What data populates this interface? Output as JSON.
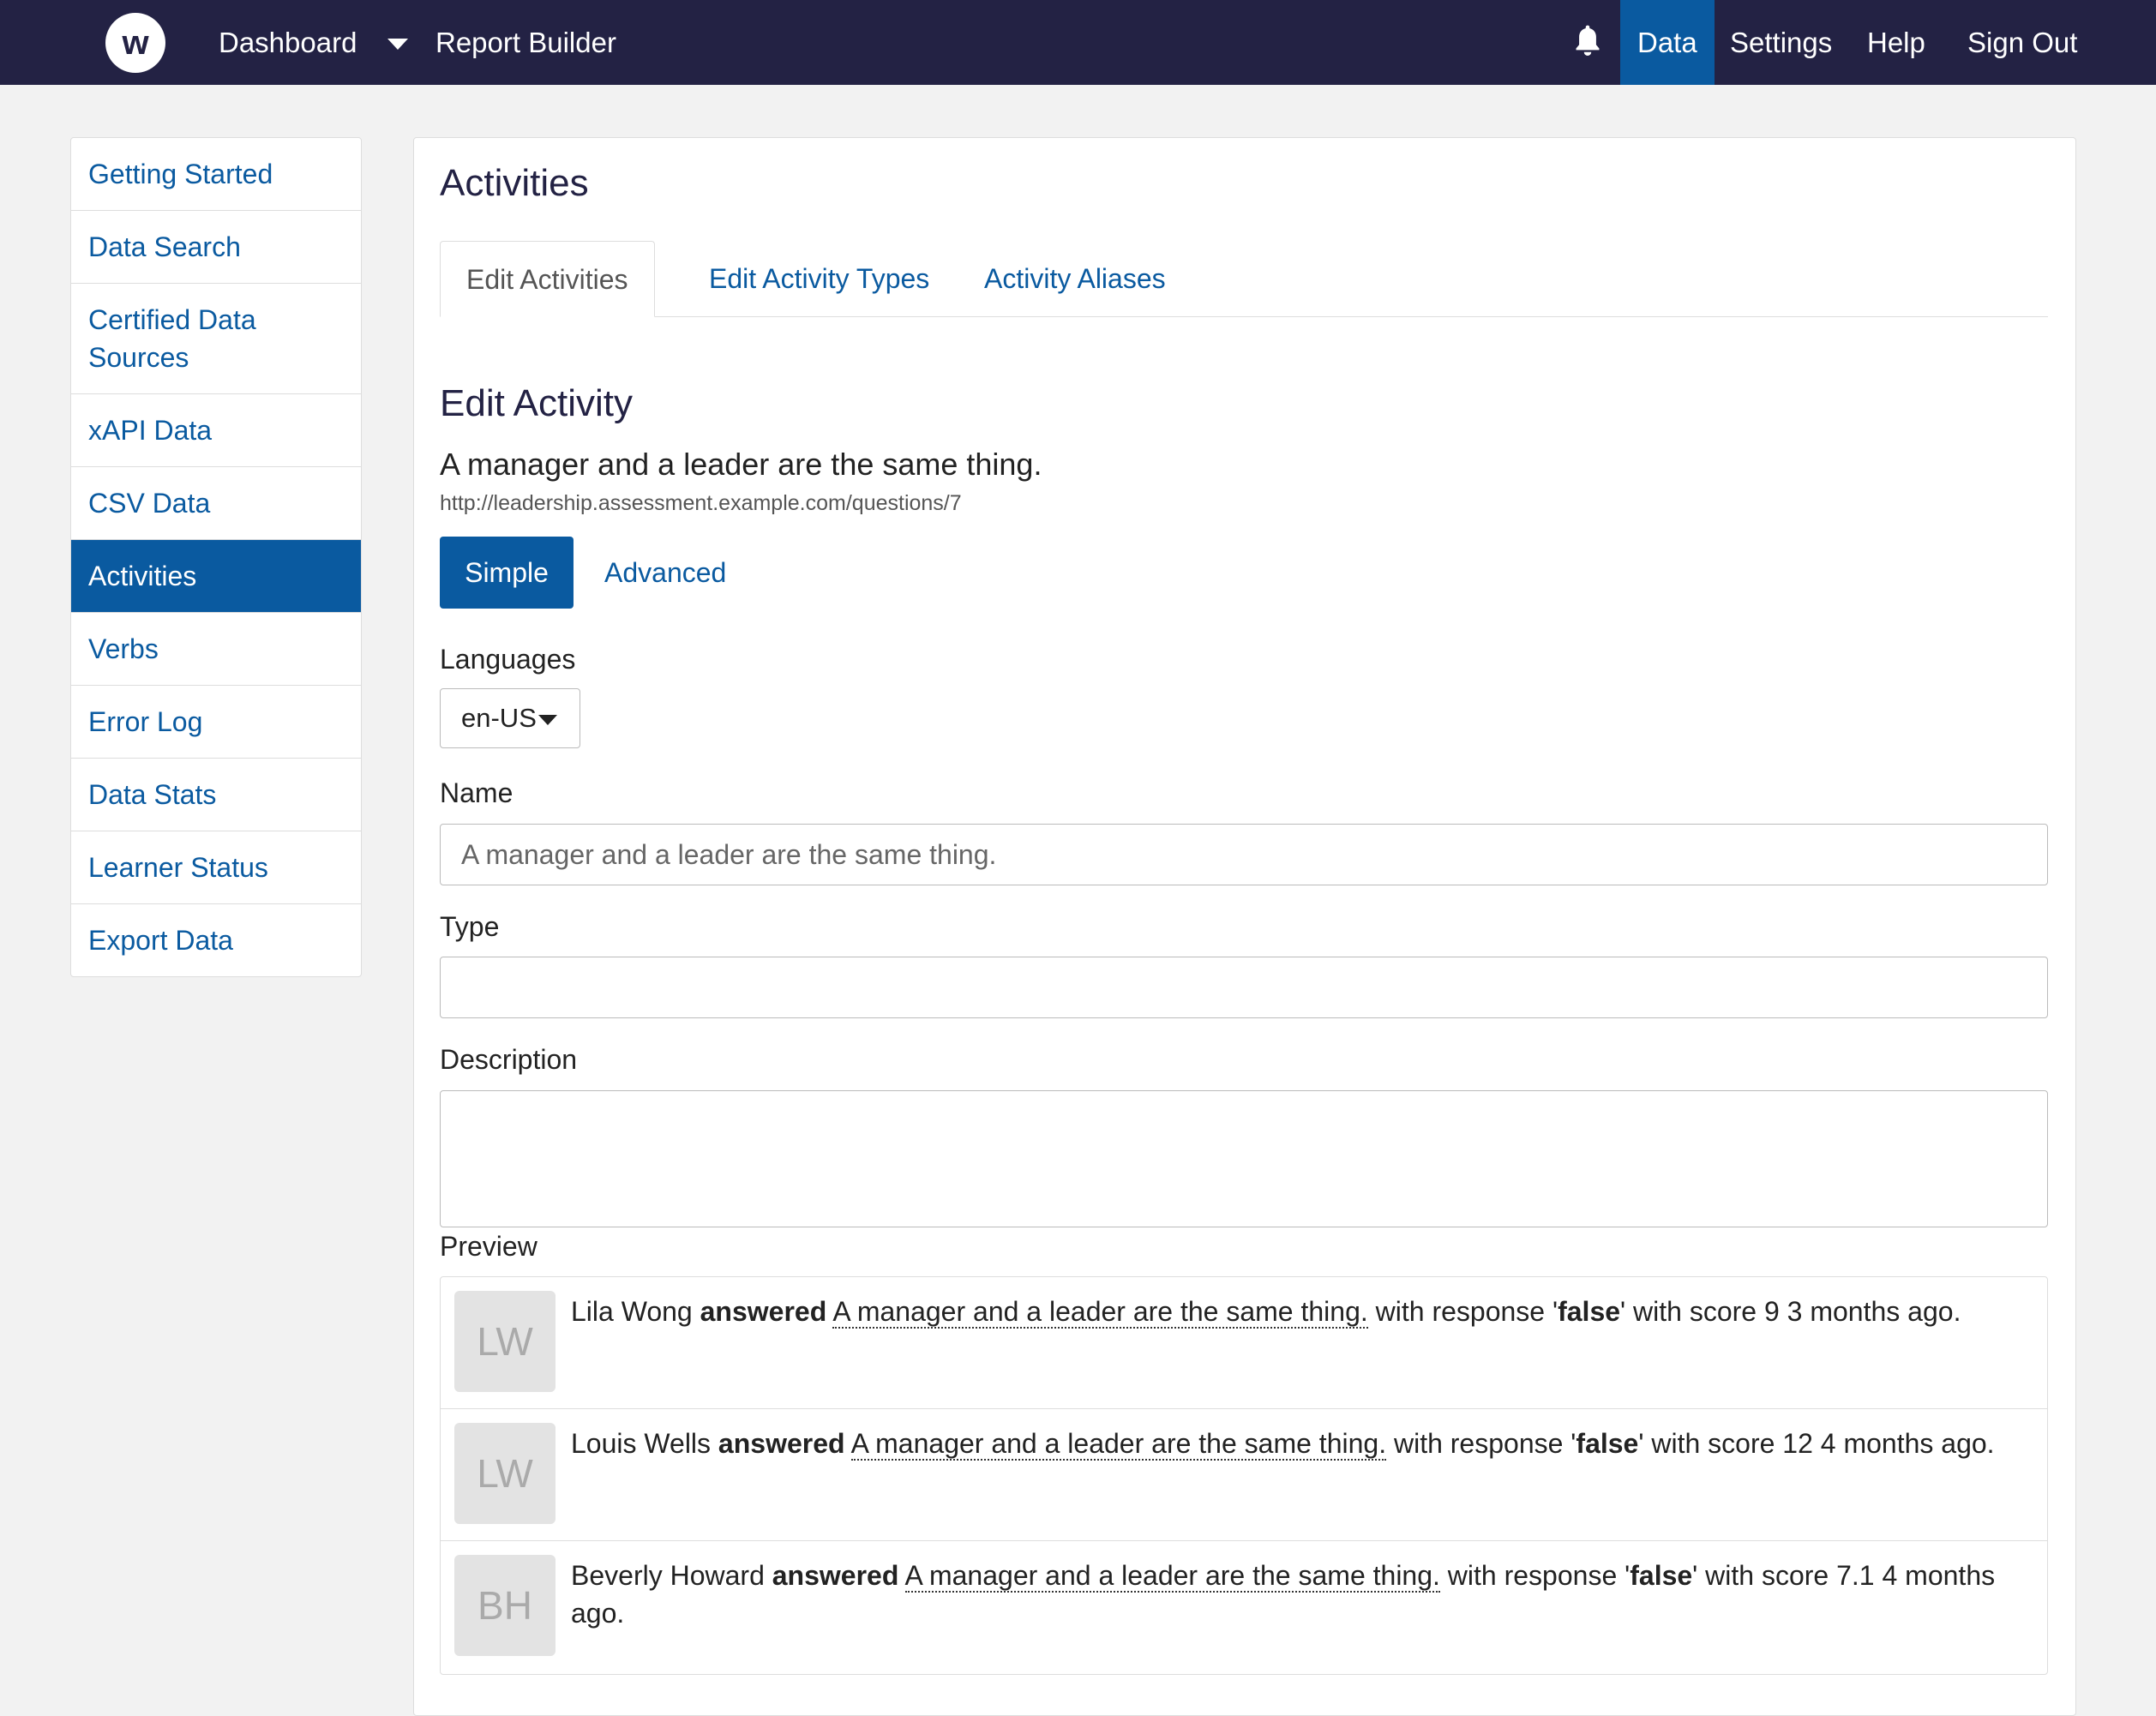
{
  "topbar": {
    "logo": "w",
    "dashboard": "Dashboard",
    "report_builder": "Report Builder",
    "data": "Data",
    "settings": "Settings",
    "help": "Help",
    "sign_out": "Sign Out"
  },
  "sidebar": {
    "items": [
      {
        "label": "Getting Started"
      },
      {
        "label": "Data Search"
      },
      {
        "label": "Certified Data Sources"
      },
      {
        "label": "xAPI Data"
      },
      {
        "label": "CSV Data"
      },
      {
        "label": "Activities"
      },
      {
        "label": "Verbs"
      },
      {
        "label": "Error Log"
      },
      {
        "label": "Data Stats"
      },
      {
        "label": "Learner Status"
      },
      {
        "label": "Export Data"
      }
    ]
  },
  "main": {
    "title": "Activities",
    "tabs": [
      {
        "label": "Edit Activities"
      },
      {
        "label": "Edit Activity Types"
      },
      {
        "label": "Activity Aliases"
      }
    ],
    "section_title": "Edit Activity",
    "activity_name": "A manager and a leader are the same thing.",
    "activity_url": "http://leadership.assessment.example.com/questions/7",
    "mode_simple": "Simple",
    "mode_advanced": "Advanced",
    "languages_label": "Languages",
    "language_value": "en-US",
    "name_label": "Name",
    "name_value": "A manager and a leader are the same thing.",
    "type_label": "Type",
    "type_value": "",
    "description_label": "Description",
    "description_value": "",
    "preview_label": "Preview",
    "preview": [
      {
        "initials": "LW",
        "actor": "Lila Wong",
        "verb": "answered",
        "object": "A manager and a leader are the same thing.",
        "pre_response": " with response '",
        "response": "false",
        "post": "' with score 9 3 months ago."
      },
      {
        "initials": "LW",
        "actor": "Louis Wells",
        "verb": "answered",
        "object": "A manager and a leader are the same thing.",
        "pre_response": " with response '",
        "response": "false",
        "post": "' with score 12 4 months ago."
      },
      {
        "initials": "BH",
        "actor": "Beverly Howard",
        "verb": "answered",
        "object": "A manager and a leader are the same thing.",
        "pre_response": " with response '",
        "response": "false",
        "post": "' with score 7.1 4 months ago."
      }
    ]
  },
  "colors": {
    "topbar_bg": "#232244",
    "accent": "#0a5aa0"
  }
}
